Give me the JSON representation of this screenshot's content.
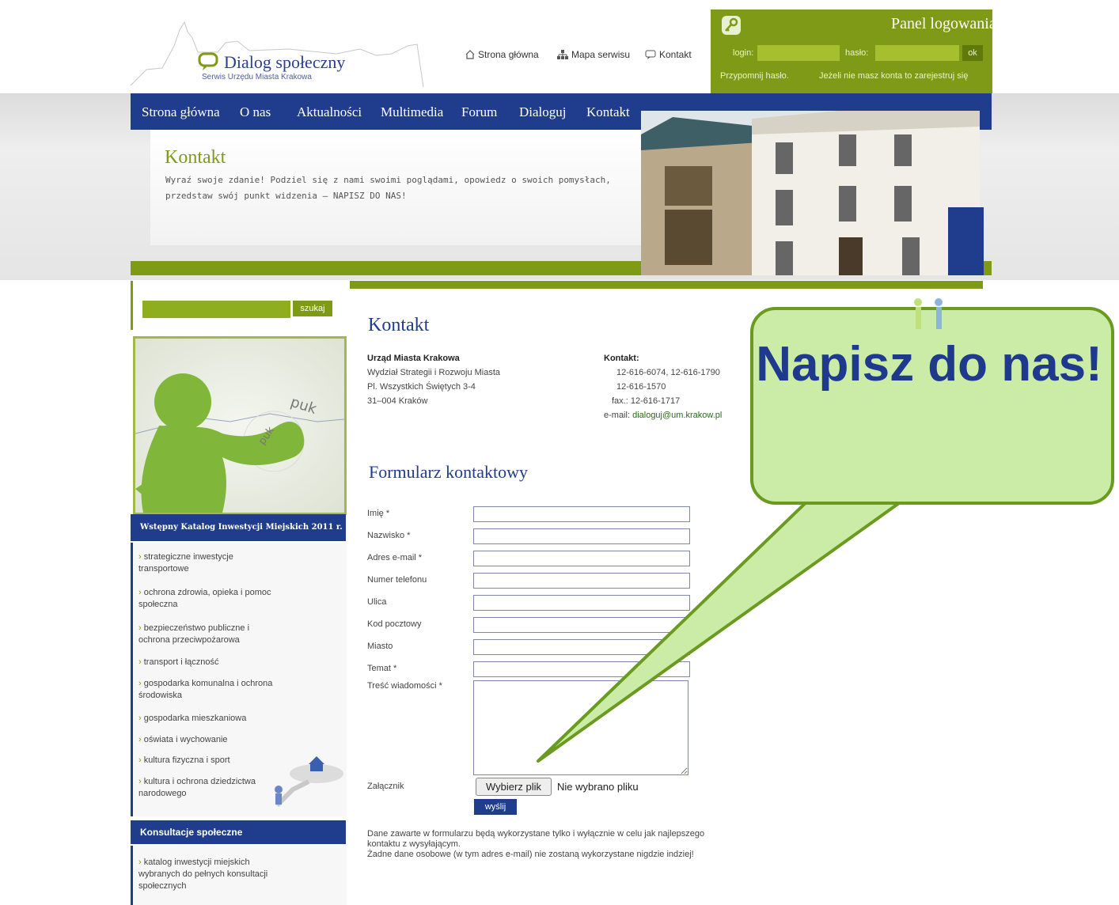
{
  "header": {
    "logo_title": "Dialog społeczny",
    "logo_subtitle": "Serwis Urzędu Miasta Krakowa",
    "top_links": [
      "Strona główna",
      "Mapa serwisu",
      "Kontakt"
    ]
  },
  "login_panel": {
    "title": "Panel logowania",
    "login_label": "login:",
    "password_label": "hasło:",
    "ok_label": "ok",
    "forgot_link": "Przypomnij hasło.",
    "register_link": "Jeżeli nie masz konta to zarejestruj się"
  },
  "nav": [
    "Strona główna",
    "O nas",
    "Aktualności",
    "Multimedia",
    "Forum",
    "Dialoguj",
    "Kontakt"
  ],
  "banner": {
    "title": "Kontakt",
    "text": "Wyraź swoje zdanie! Podziel się z nami swoimi poglądami, opowiedz o swoich pomysłach, przedstaw swój punkt widzenia – NAPISZ DO NAS!"
  },
  "sidebar": {
    "search_button": "szukaj",
    "mascot_words": [
      "puk",
      "puk"
    ],
    "catalog_header": "Wstępny Katalog Inwestycji Miejskich 2011 r.",
    "catalog_items": [
      "strategiczne inwestycje transportowe",
      "ochrona zdrowia, opieka i pomoc społeczna",
      "bezpieczeństwo publiczne i ochrona przeciwpożarowa",
      "transport i łączność",
      "gospodarka komunalna i ochrona środowiska",
      "gospodarka mieszkaniowa",
      "oświata i wychowanie",
      "kultura fizyczna i sport",
      "kultura i ochrona dziedzictwa narodowego"
    ],
    "consult_header": "Konsultacje społeczne",
    "consult_items": [
      "katalog inwestycji miejskich wybranych do pełnych konsultacji społecznych"
    ]
  },
  "main": {
    "title": "Kontakt",
    "address": {
      "name": "Urząd Miasta Krakowa",
      "lines": [
        "Wydział Strategii i Rozwoju Miasta",
        "Pl. Wszystkich Świętych 3-4",
        "31–004 Kraków"
      ]
    },
    "contact": {
      "heading": "Kontakt:",
      "phones1": "12-616-6074, 12-616-1790",
      "phones2": "12-616-1570",
      "fax": "fax.: 12-616-1717",
      "email_label": "e-mail:",
      "email": "dialoguj@um.krakow.pl"
    },
    "form_title": "Formularz kontaktowy",
    "fields": [
      "Imię *",
      "Nazwisko *",
      "Adres e-mail *",
      "Numer telefonu",
      "Ulica",
      "Kod pocztowy",
      "Miasto",
      "Temat *"
    ],
    "message_label": "Treść wiadomości *",
    "attachment_label": "Załącznik",
    "file_button": "Wybierz plik",
    "file_status": "Nie wybrano pliku",
    "send_button": "wyślij",
    "privacy_line1": "Dane zawarte w formularzu będą wykorzystane tylko i wyłącznie w celu jak najlepszego kontaktu z wysyłającym.",
    "privacy_line2": "Żadne dane osobowe (w tym adres e-mail) nie zostaną wykorzystane nigdzie indziej!"
  },
  "callout": {
    "text": "Napisz do nas!"
  },
  "colors": {
    "brand_green": "#7f9a17",
    "brand_blue": "#1f3d8c",
    "callout_fill": "#cbeca7",
    "callout_border": "#6a9a1f"
  }
}
